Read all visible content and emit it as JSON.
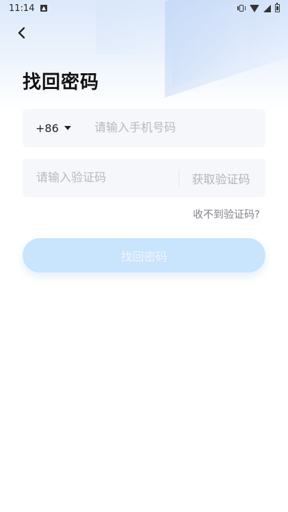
{
  "status_bar": {
    "time": "11:14"
  },
  "header": {
    "title": "找回密码"
  },
  "phone": {
    "country_code": "+86",
    "placeholder": "请输入手机号码"
  },
  "verification": {
    "placeholder": "请输入验证码",
    "get_code_label": "获取验证码"
  },
  "no_code_link": "收不到验证码?",
  "submit_label": "找回密码",
  "colors": {
    "submit_bg": "#c9e4fd",
    "field_bg": "#f6f7fb",
    "placeholder": "#b7bac2"
  }
}
